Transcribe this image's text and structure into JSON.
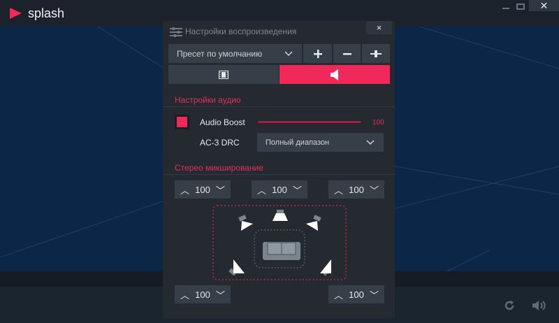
{
  "app": {
    "name": "splash",
    "accent": "#ef2a5a"
  },
  "window": {
    "minimize": "minimize",
    "maximize": "maximize",
    "close": "close"
  },
  "panel": {
    "title": "Настройки воспроизведения",
    "close_label": "×",
    "preset": {
      "value": "Пресет по умолчанию"
    },
    "tabs": [
      {
        "icon": "film-icon",
        "active": false
      },
      {
        "icon": "speaker-icon",
        "active": true
      }
    ],
    "audio_section": "Настройки аудио",
    "audio_boost": {
      "label": "Audio Boost",
      "checked": true,
      "value": "100"
    },
    "drc": {
      "label": "AC-3 DRC",
      "value": "Полный диапазон"
    },
    "stereo_section": "Стерео микширование",
    "channels": {
      "front_left": "100",
      "center": "100",
      "front_right": "100",
      "rear_left": "100",
      "rear_right": "100"
    }
  }
}
